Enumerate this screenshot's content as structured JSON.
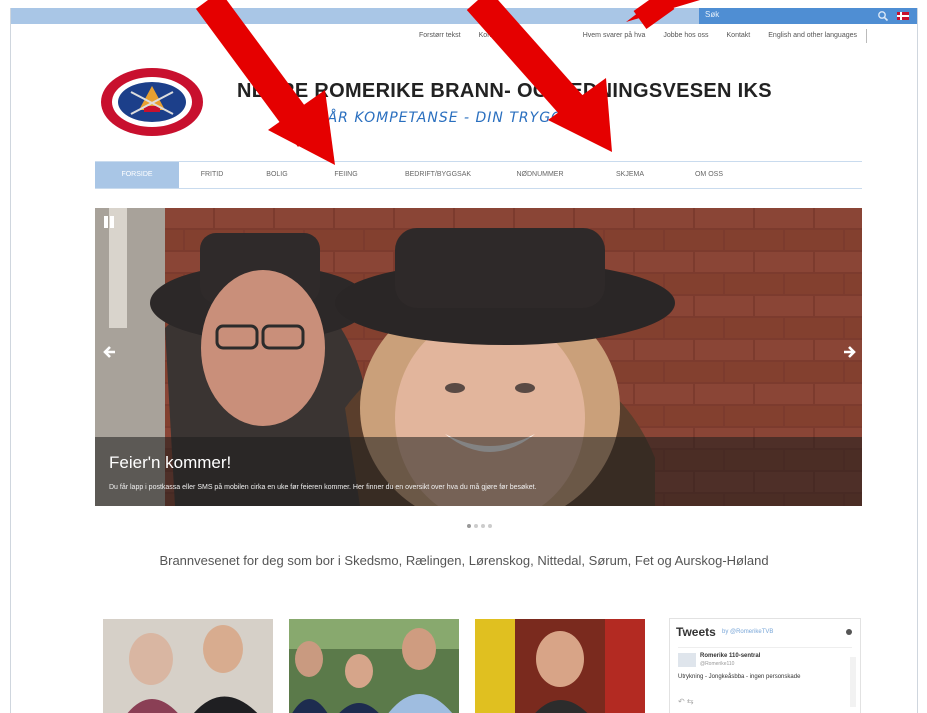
{
  "topbar": {
    "search_text": "Søk",
    "search_icon": "search-icon",
    "flag_icon": "uk-flag-icon"
  },
  "utility_links": [
    "Forstørr tekst",
    "Kontrast",
    "Hvem svarer på hva",
    "Jobbe hos oss",
    "Kontakt",
    "English and other languages"
  ],
  "header": {
    "title": "NEDRE ROMERIKE BRANN- OG REDNINGSVESEN IKS",
    "tagline": "VÅR KOMPETANSE - DIN TRYGGHET"
  },
  "nav": {
    "items": [
      "Forside",
      "Fritid",
      "Bolig",
      "Feiing",
      "Bedrift/byggsak",
      "Nødnummer",
      "Skjema",
      "Om oss"
    ],
    "active_index": 0
  },
  "slider": {
    "caption_title": "Feier'n kommer!",
    "caption_text": "Du får lapp i postkassa eller SMS på mobilen cirka en uke før feieren kommer. Her finner du en oversikt over hva du må gjøre før besøket.",
    "slide_count": 4,
    "active_slide": 1
  },
  "intro_text": "Brannvesenet for deg som bor i Skedsmo, Rælingen, Lørenskog, Nittedal, Sørum, Fet og Aurskog-Høland",
  "tweets": {
    "title": "Tweets",
    "by": "by @RomerikeTVB",
    "author": "Romerike 110-sentral",
    "handle": "@Romerike110",
    "text": "Utrykning - Jongkeåsbba - ingen personskade",
    "actions": "↶ ⇆"
  },
  "colors": {
    "accent": "#a9c6e6",
    "accent_dark": "#4f8ed3",
    "annotation": "#e50000",
    "tagline": "#2a6fbf"
  }
}
